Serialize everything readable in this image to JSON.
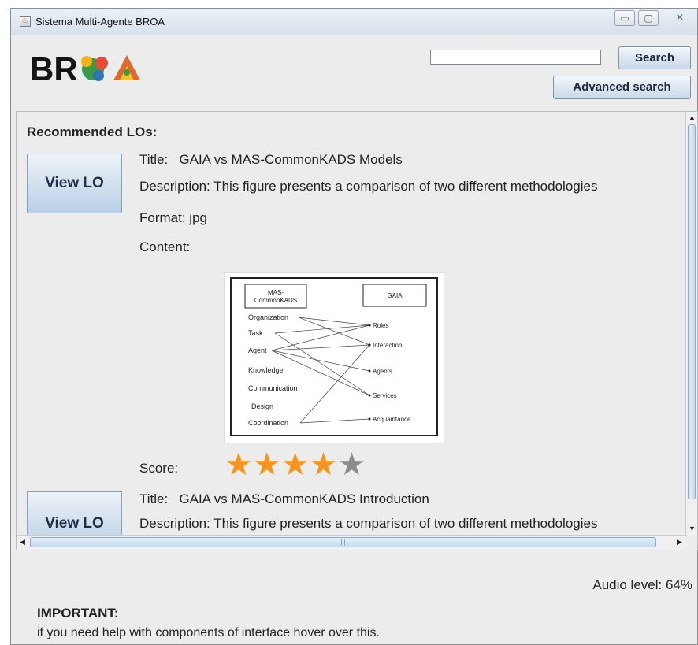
{
  "window": {
    "title": "Sistema Multi-Agente BROA",
    "controls": [
      "minimize",
      "maximize",
      "close"
    ]
  },
  "header": {
    "logo_text": "BROA",
    "search": {
      "value": "",
      "button_label": "Search"
    },
    "advanced_search_label": "Advanced search"
  },
  "recommended": {
    "section_title": "Recommended LOs:",
    "items": [
      {
        "view_label": "View LO",
        "title_label": "Title:",
        "title": "GAIA vs MAS-CommonKADS Models",
        "description_label": "Description:",
        "description": "This figure presents a comparison of two different methodologies",
        "format_label": "Format:",
        "format": "jpg",
        "content_label": "Content:",
        "figure": {
          "left_header": "MAS-\nCommonKADS",
          "right_header": "GAIA",
          "left_items": [
            "Organization",
            "Task",
            "Agent",
            "Knowledge",
            "Communication",
            "Design",
            "Coordination"
          ],
          "right_items": [
            "Roles",
            "Interaction",
            "Agents",
            "Services",
            "Acquaintance"
          ]
        },
        "score_label": "Score:",
        "score": 4,
        "score_max": 5
      },
      {
        "view_label": "View LO",
        "title_label": "Title:",
        "title": "GAIA vs MAS-CommonKADS Introduction",
        "description_label": "Description:",
        "description": "This figure presents a comparison of two different methodologies"
      }
    ]
  },
  "footer": {
    "audio_level": "Audio level: 64%",
    "important_title": "IMPORTANT:",
    "important_text": "if you need help with components of interface hover over this."
  },
  "colors": {
    "star_filled": "#f7941d",
    "star_empty": "#8c8c8c",
    "accent": "#c6dbf3"
  }
}
